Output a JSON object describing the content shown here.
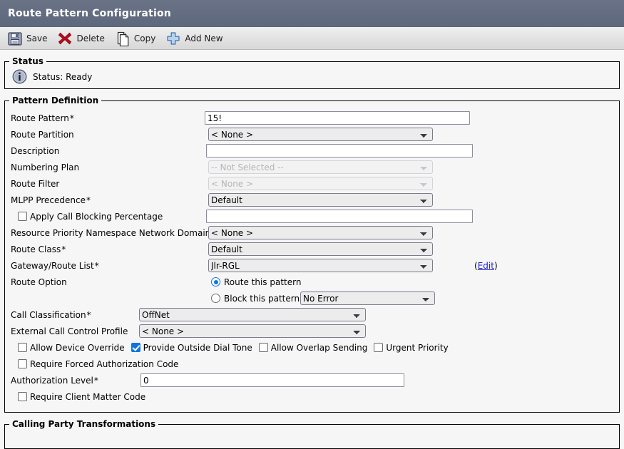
{
  "window": {
    "title": "Route Pattern Configuration"
  },
  "toolbar": {
    "buttons": [
      {
        "label": "Save",
        "icon": "floppy-disk-icon"
      },
      {
        "label": "Delete",
        "icon": "red-x-icon"
      },
      {
        "label": "Copy",
        "icon": "copy-document-icon"
      },
      {
        "label": "Add New",
        "icon": "blue-plus-icon"
      }
    ]
  },
  "status": {
    "legend": "Status",
    "icon": "info-icon",
    "text": "Status: Ready"
  },
  "pattern_definition": {
    "legend": "Pattern Definition",
    "route_pattern": {
      "label": "Route Pattern",
      "required": "*",
      "value": "15!"
    },
    "route_partition": {
      "label": "Route Partition",
      "value": "< None >"
    },
    "description": {
      "label": "Description",
      "value": ""
    },
    "numbering_plan": {
      "label": "Numbering Plan",
      "value": "-- Not Selected --"
    },
    "route_filter": {
      "label": "Route Filter",
      "value": "< None >"
    },
    "mlpp_precedence": {
      "label": "MLPP Precedence",
      "required": "*",
      "value": "Default"
    },
    "apply_call_blocking": {
      "label": "Apply Call Blocking Percentage",
      "checked": false,
      "value": ""
    },
    "resource_priority_domain": {
      "label": "Resource Priority Namespace Network Domain",
      "value": "< None >"
    },
    "route_class": {
      "label": "Route Class",
      "required": "*",
      "value": "Default"
    },
    "gateway_route_list": {
      "label": "Gateway/Route List",
      "required": "*",
      "value": "Jlr-RGL",
      "edit_link": "Edit",
      "paren_open": "(",
      "paren_close": ")"
    },
    "route_option": {
      "label": "Route Option",
      "route_this_pattern": "Route this pattern",
      "block_this_pattern": "Block this pattern",
      "selected": "route",
      "block_reason": "No Error"
    },
    "call_classification": {
      "label": "Call Classification",
      "required": "*",
      "value": "OffNet"
    },
    "external_call_control_profile": {
      "label": "External Call Control Profile",
      "value": "< None >"
    },
    "checkbox_row": [
      {
        "label": "Allow Device Override",
        "checked": false
      },
      {
        "label": "Provide Outside Dial Tone",
        "checked": true
      },
      {
        "label": "Allow Overlap Sending",
        "checked": false
      },
      {
        "label": "Urgent Priority",
        "checked": false
      }
    ],
    "require_forced_auth_code": {
      "label": "Require Forced Authorization Code",
      "checked": false
    },
    "authorization_level": {
      "label": "Authorization Level",
      "required": "*",
      "value": "0"
    },
    "require_client_matter_code": {
      "label": "Require Client Matter Code",
      "checked": false
    }
  },
  "calling_party_transformations": {
    "legend": "Calling Party Transformations"
  }
}
